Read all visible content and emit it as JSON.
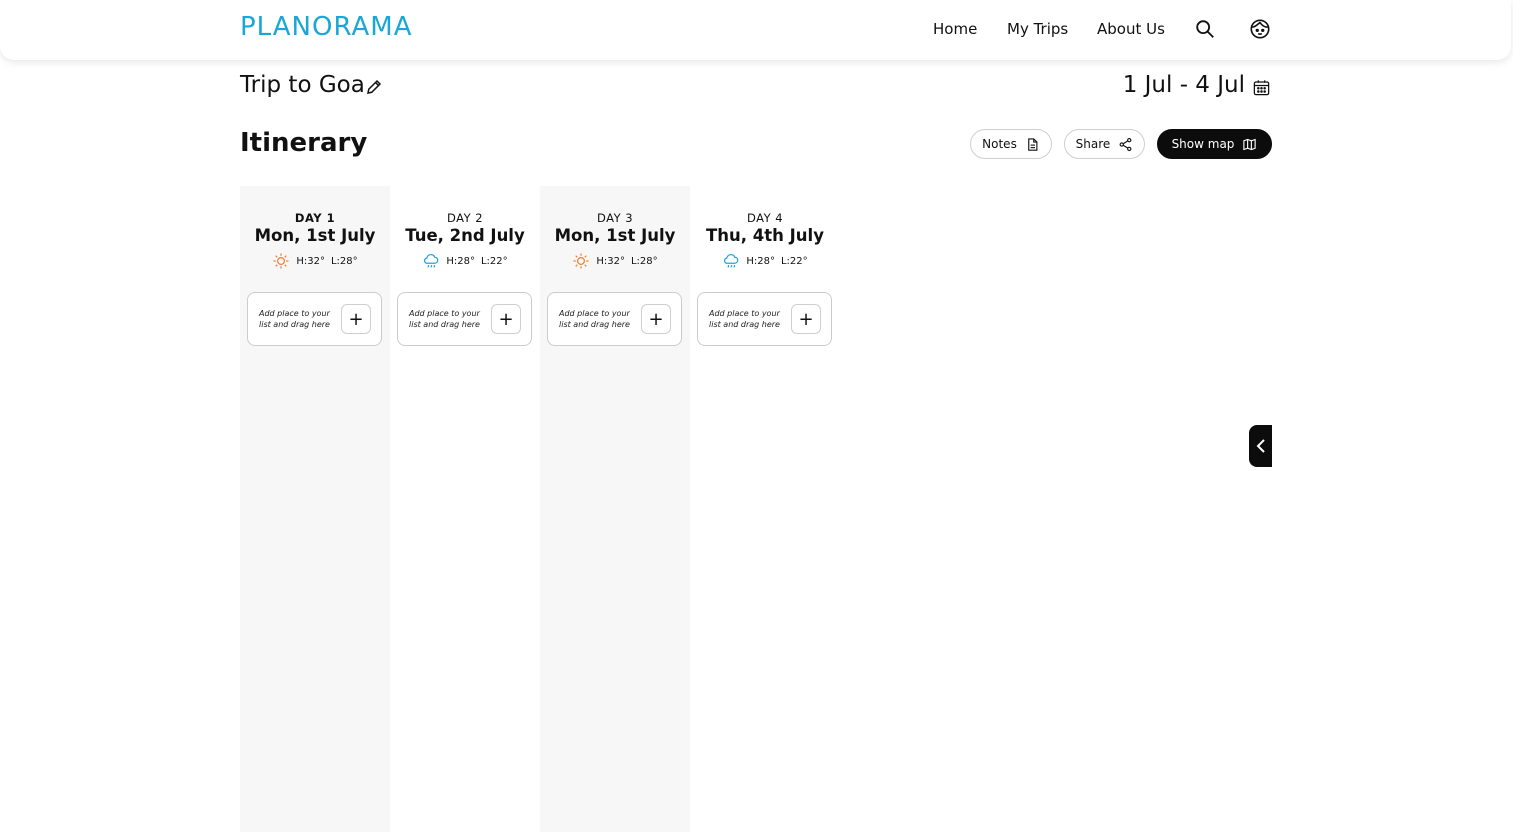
{
  "brand": {
    "logo_text": "PLANORAMA",
    "accent": "#1aa7d6"
  },
  "nav": {
    "links": [
      "Home",
      "My Trips",
      "About Us"
    ],
    "search_icon": "search-icon",
    "profile_icon": "profile-face-icon"
  },
  "trip": {
    "title": "Trip to Goa",
    "date_range": "1 Jul - 4 Jul"
  },
  "itinerary": {
    "title": "Itinerary",
    "buttons": {
      "notes": "Notes",
      "share": "Share",
      "show_map": "Show map"
    },
    "days": [
      {
        "label": "DAY 1",
        "date": "Mon, 1st July",
        "weather_icon": "sun-icon",
        "high": "H:32°",
        "low": "L:28°",
        "add_hint": "Add place to your list and drag here"
      },
      {
        "label": "DAY 2",
        "date": "Tue, 2nd July",
        "weather_icon": "rain-cloud-icon",
        "high": "H:28°",
        "low": "L:22°",
        "add_hint": "Add place to your list and drag here"
      },
      {
        "label": "DAY 3",
        "date": "Mon, 1st July",
        "weather_icon": "sun-icon",
        "high": "H:32°",
        "low": "L:28°",
        "add_hint": "Add place to your list and drag here"
      },
      {
        "label": "DAY 4",
        "date": "Thu, 4th July",
        "weather_icon": "rain-cloud-icon",
        "high": "H:28°",
        "low": "L:22°",
        "add_hint": "Add place to your list and drag here"
      }
    ]
  },
  "colors": {
    "sun": "#f07a2a",
    "rain": "#1aa7d6",
    "dark": "#0c0c0c"
  }
}
